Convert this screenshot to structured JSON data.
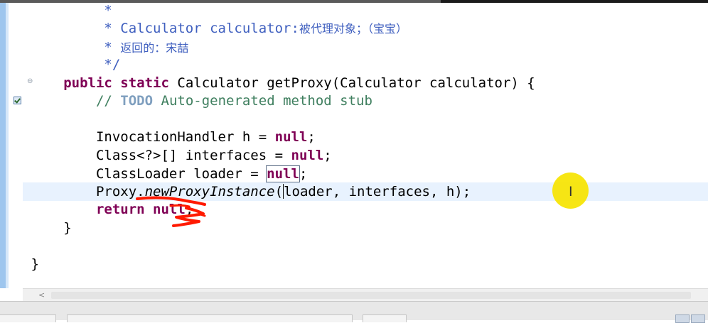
{
  "editor": {
    "lines": [
      "*",
      "* Calculator calculator:",
      "被代理对象；（宝宝）",
      "* ",
      "返回的：宋喆",
      "*/",
      "public",
      "static",
      "Calculator getProxy(Calculator calculator) {",
      "// ",
      "TODO",
      "Auto-generated method stub",
      "InvocationHandler h = ",
      "null",
      ";",
      "Class<?>[] interfaces = ",
      "null",
      ";",
      "ClassLoader loader = ",
      "null",
      ";",
      "Proxy.",
      "newProxyInstance",
      "(",
      "loader, interfaces, h);",
      "return",
      "null",
      ";",
      "}",
      "}"
    ]
  },
  "colors": {
    "keyword": "#7f0055",
    "javadoc": "#3f5fbf",
    "comment": "#3f7f5f",
    "current_line": "#e8f2fe",
    "cursor_highlight": "#f6e400",
    "annotation": "#ff1a00"
  },
  "icons": {
    "fold": "minus-circle-icon",
    "task": "task-checkbox-icon",
    "text_cursor": "ibeam-icon",
    "scroll_left": "chevron-left-icon"
  },
  "glyphs": {
    "fold": "⊖",
    "ibeam": "I",
    "scroll_left": "<"
  }
}
